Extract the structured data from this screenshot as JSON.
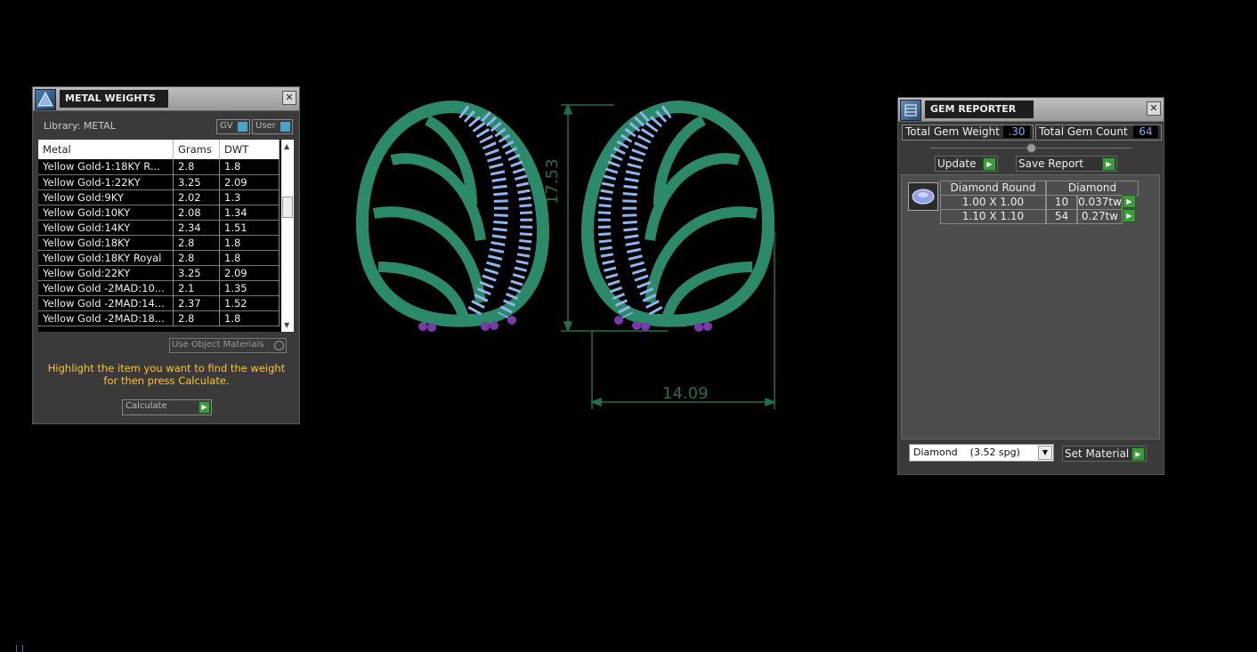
{
  "metal_panel": {
    "title": "METAL WEIGHTS",
    "close": "✕",
    "library_label": "Library: METAL",
    "gv_label": "GV",
    "user_label": "User",
    "columns": [
      "Metal",
      "Grams",
      "DWT"
    ],
    "rows": [
      [
        "Yellow Gold-1:18KY R...",
        "2.8",
        "1.8"
      ],
      [
        "Yellow Gold-1:22KY",
        "3.25",
        "2.09"
      ],
      [
        "Yellow Gold:9KY",
        "2.02",
        "1.3"
      ],
      [
        "Yellow Gold:10KY",
        "2.08",
        "1.34"
      ],
      [
        "Yellow Gold:14KY",
        "2.34",
        "1.51"
      ],
      [
        "Yellow Gold:18KY",
        "2.8",
        "1.8"
      ],
      [
        "Yellow Gold:18KY Royal",
        "2.8",
        "1.8"
      ],
      [
        "Yellow Gold:22KY",
        "3.25",
        "2.09"
      ],
      [
        "Yellow Gold -2MAD:10...",
        "2.1",
        "1.35"
      ],
      [
        "Yellow Gold -2MAD:14...",
        "2.37",
        "1.52"
      ],
      [
        "Yellow Gold -2MAD:18...",
        "2.8",
        "1.8"
      ]
    ],
    "use_object_materials": "Use Object Materials",
    "instruction": "Highlight the item you want to find the weight for then press Calculate.",
    "calculate_label": "Calculate"
  },
  "gem_panel": {
    "title": "GEM REPORTER",
    "close": "✕",
    "total_weight_label": "Total Gem Weight",
    "total_weight_value": ".30",
    "total_count_label": "Total Gem Count",
    "total_count_value": "64",
    "update_label": "Update",
    "save_report_label": "Save Report",
    "table_header": [
      "Diamond Round",
      "Diamond"
    ],
    "rows": [
      {
        "size": "1.00 X 1.00",
        "count": "10",
        "weight": "0.037tw"
      },
      {
        "size": "1.10 X 1.10",
        "count": "54",
        "weight": "0.27tw"
      }
    ],
    "material_select": "Diamond    (3.52 spg)",
    "set_material_label": "Set Material"
  },
  "viewport": {
    "dim_height": "17.53",
    "dim_width": "14.09"
  },
  "colors": {
    "metal": "#2a8a6a",
    "gem": "#8fb4ee",
    "prong": "#7a3aa8",
    "dimension": "#1f6f4e",
    "highlight_text": "#ffc52a"
  }
}
